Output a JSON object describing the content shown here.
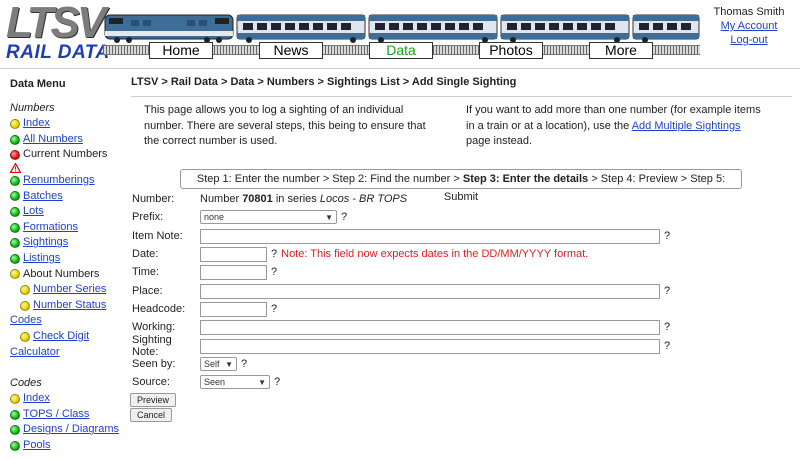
{
  "header": {
    "logo_top": "LTSV",
    "logo_bottom": "RAIL DATA",
    "nav": [
      {
        "label": "Home",
        "active": false
      },
      {
        "label": "News",
        "active": false
      },
      {
        "label": "Data",
        "active": true
      },
      {
        "label": "Photos",
        "active": false
      },
      {
        "label": "More",
        "active": false
      }
    ],
    "user": {
      "name": "Thomas Smith",
      "account_link": "My Account",
      "logout_link": "Log-out"
    }
  },
  "sidebar": {
    "title": "Data Menu",
    "numbers_heading": "Numbers",
    "numbers_items": [
      "Index",
      "All Numbers",
      "Current Numbers",
      "Renumberings",
      "Batches",
      "Lots",
      "Formations",
      "Sightings",
      "Listings",
      "About Numbers",
      "Number Series",
      "Number Status"
    ],
    "codes_link": "Codes",
    "check_digit": "Check Digit",
    "calculator": "Calculator",
    "codes_heading": "Codes",
    "codes_items": [
      "Index",
      "TOPS / Class",
      "Designs / Diagrams",
      "Pools"
    ]
  },
  "breadcrumb": "LTSV > Rail Data > Data > Numbers > Sightings List > Add Single Sighting",
  "intro": {
    "left": "This page allows you to log a sighting of an individual number. There are several steps, this being to ensure that the correct number is used.",
    "right_before": "If you want to add more than one number (for example items in a train or at a location), use the ",
    "right_link": "Add Multiple Sightings",
    "right_after": " page instead."
  },
  "steps": {
    "before": "Step 1: Enter the number > Step 2: Find the number > ",
    "current": "Step 3: Enter the details",
    "after": " > Step 4: Preview > Step 5: Submit"
  },
  "form": {
    "number_label": "Number:",
    "number_prefix": "Number ",
    "number_value": "70801",
    "number_mid": " in series ",
    "number_series": "Locos - BR TOPS",
    "prefix_label": "Prefix:",
    "prefix_value": "none",
    "item_note_label": "Item Note:",
    "date_label": "Date:",
    "date_note": "Note: This field now expects dates in the DD/MM/YYYY format.",
    "time_label": "Time:",
    "place_label": "Place:",
    "headcode_label": "Headcode:",
    "working_label": "Working:",
    "sighting_note_label": "Sighting Note:",
    "seen_by_label": "Seen by:",
    "seen_by_value": "Self",
    "source_label": "Source:",
    "source_value": "Seen",
    "help": "?",
    "preview_button": "Preview",
    "cancel_button": "Cancel"
  }
}
